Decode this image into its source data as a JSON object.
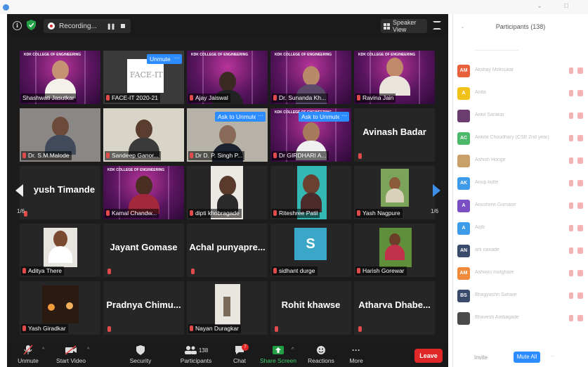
{
  "meeting": {
    "recording_label": "Recording...",
    "speaker_view_label": "Speaker View",
    "page_left": "1/6",
    "page_right": "1/6"
  },
  "tiles": [
    {
      "name": "Shashwati Jasutkar"
    },
    {
      "name": "FACE-IT 2020-21",
      "tag": "Unmute",
      "logo_text": "FACE-IT"
    },
    {
      "name": "Ajay Jaiswal"
    },
    {
      "name": "Dr. Sunanda Kh..."
    },
    {
      "name": "Ravina Jain"
    },
    {
      "name": "Dr. S.M.Malode"
    },
    {
      "name": "Sandeep Ganor..."
    },
    {
      "name": "Dr D. P. Singh P...",
      "tag": "Ask to Unmute"
    },
    {
      "name": "Dr GIRDHARI A...",
      "tag": "Ask to Unmute"
    },
    {
      "big": "Avinash Badar"
    },
    {
      "big": "yush Timande"
    },
    {
      "name": "Kamal Chandw..."
    },
    {
      "name": "dipti khobragade"
    },
    {
      "name": "Riteshree Patil"
    },
    {
      "name": "Yash Nagpure"
    },
    {
      "name": "Aditya There"
    },
    {
      "big": "Jayant Gomase"
    },
    {
      "big": "Achal punyapre..."
    },
    {
      "name": "sidhant durge",
      "letter": "S"
    },
    {
      "name": "Harish Gorewar"
    },
    {
      "name": "Yash Giradkar"
    },
    {
      "big": "Pradnya Chimu..."
    },
    {
      "name": "Nayan Duragkar"
    },
    {
      "big": "Rohit khawse"
    },
    {
      "big": "Atharva Dhabe..."
    }
  ],
  "banner_text": "KDK COLLEGE OF ENGINEERING",
  "toolbar": {
    "unmute": "Unmute",
    "start_video": "Start Video",
    "security": "Security",
    "participants": "Participants",
    "participants_count": "138",
    "chat": "Chat",
    "chat_badge": "7",
    "share_screen": "Share Screen",
    "reactions": "Reactions",
    "more": "More",
    "leave": "Leave"
  },
  "panel": {
    "title": "Participants (138)",
    "participants": [
      {
        "initials": "AM",
        "color": "#e8603c",
        "name": "Akshay Moksukar"
      },
      {
        "initials": "A",
        "color": "#f2c21b",
        "name": "Anita"
      },
      {
        "initials": "",
        "color": "#6b3d6e",
        "name": "Ankit Sarakar"
      },
      {
        "initials": "AC",
        "color": "#4bb86a",
        "name": "Ankita Choudhary (CSE 2nd year)"
      },
      {
        "initials": "",
        "color": "#c9a06a",
        "name": "Ashish Honge"
      },
      {
        "initials": "AK",
        "color": "#3d9be9",
        "name": "Anup kutte"
      },
      {
        "initials": "A",
        "color": "#7a4fc4",
        "name": "Anushree Gomase"
      },
      {
        "initials": "A",
        "color": "#3d9be9",
        "name": "Aqib"
      },
      {
        "initials": "AN",
        "color": "#3a4a6b",
        "name": "arti naxade"
      },
      {
        "initials": "AM",
        "color": "#f08a3c",
        "name": "Ashwini motghare"
      },
      {
        "initials": "BS",
        "color": "#3a4a6b",
        "name": "Bhagyashri Sahare"
      },
      {
        "initials": "",
        "color": "#4a4a4a",
        "name": "Bhavesh Ambagade"
      }
    ],
    "invite": "Invite",
    "mute_all": "Mute All",
    "more": "..."
  }
}
